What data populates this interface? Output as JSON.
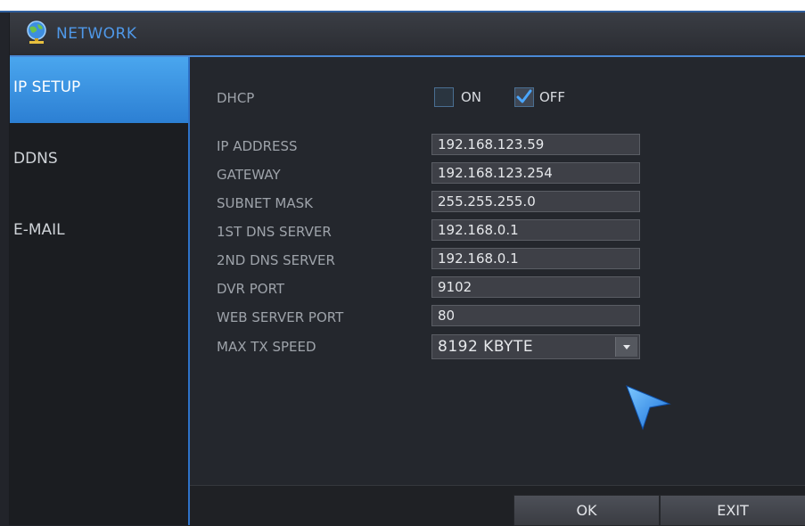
{
  "window": {
    "title": "NETWORK",
    "title_icon": "network-globe-icon"
  },
  "sidebar": {
    "items": [
      {
        "label": "IP SETUP",
        "active": true
      },
      {
        "label": "DDNS",
        "active": false
      },
      {
        "label": "E-MAIL",
        "active": false
      }
    ]
  },
  "dhcp": {
    "label": "DHCP",
    "on_label": "ON",
    "on_checked": false,
    "off_label": "OFF",
    "off_checked": true
  },
  "fields": [
    {
      "label": "IP ADDRESS",
      "value": "192.168.123.59"
    },
    {
      "label": "GATEWAY",
      "value": "192.168.123.254"
    },
    {
      "label": "SUBNET MASK",
      "value": "255.255.255.0"
    },
    {
      "label": "1ST DNS SERVER",
      "value": "192.168.0.1"
    },
    {
      "label": "2ND DNS SERVER",
      "value": "192.168.0.1"
    },
    {
      "label": "DVR PORT",
      "value": "9102"
    },
    {
      "label": "WEB SERVER PORT",
      "value": "80"
    }
  ],
  "max_tx": {
    "label": "MAX TX SPEED",
    "value": "8192 KBYTE"
  },
  "buttons": {
    "ok": "OK",
    "exit": "EXIT"
  },
  "colors": {
    "accent": "#4a89d6",
    "active_tab": "#3a96e6",
    "check": "#4aa6ff"
  }
}
